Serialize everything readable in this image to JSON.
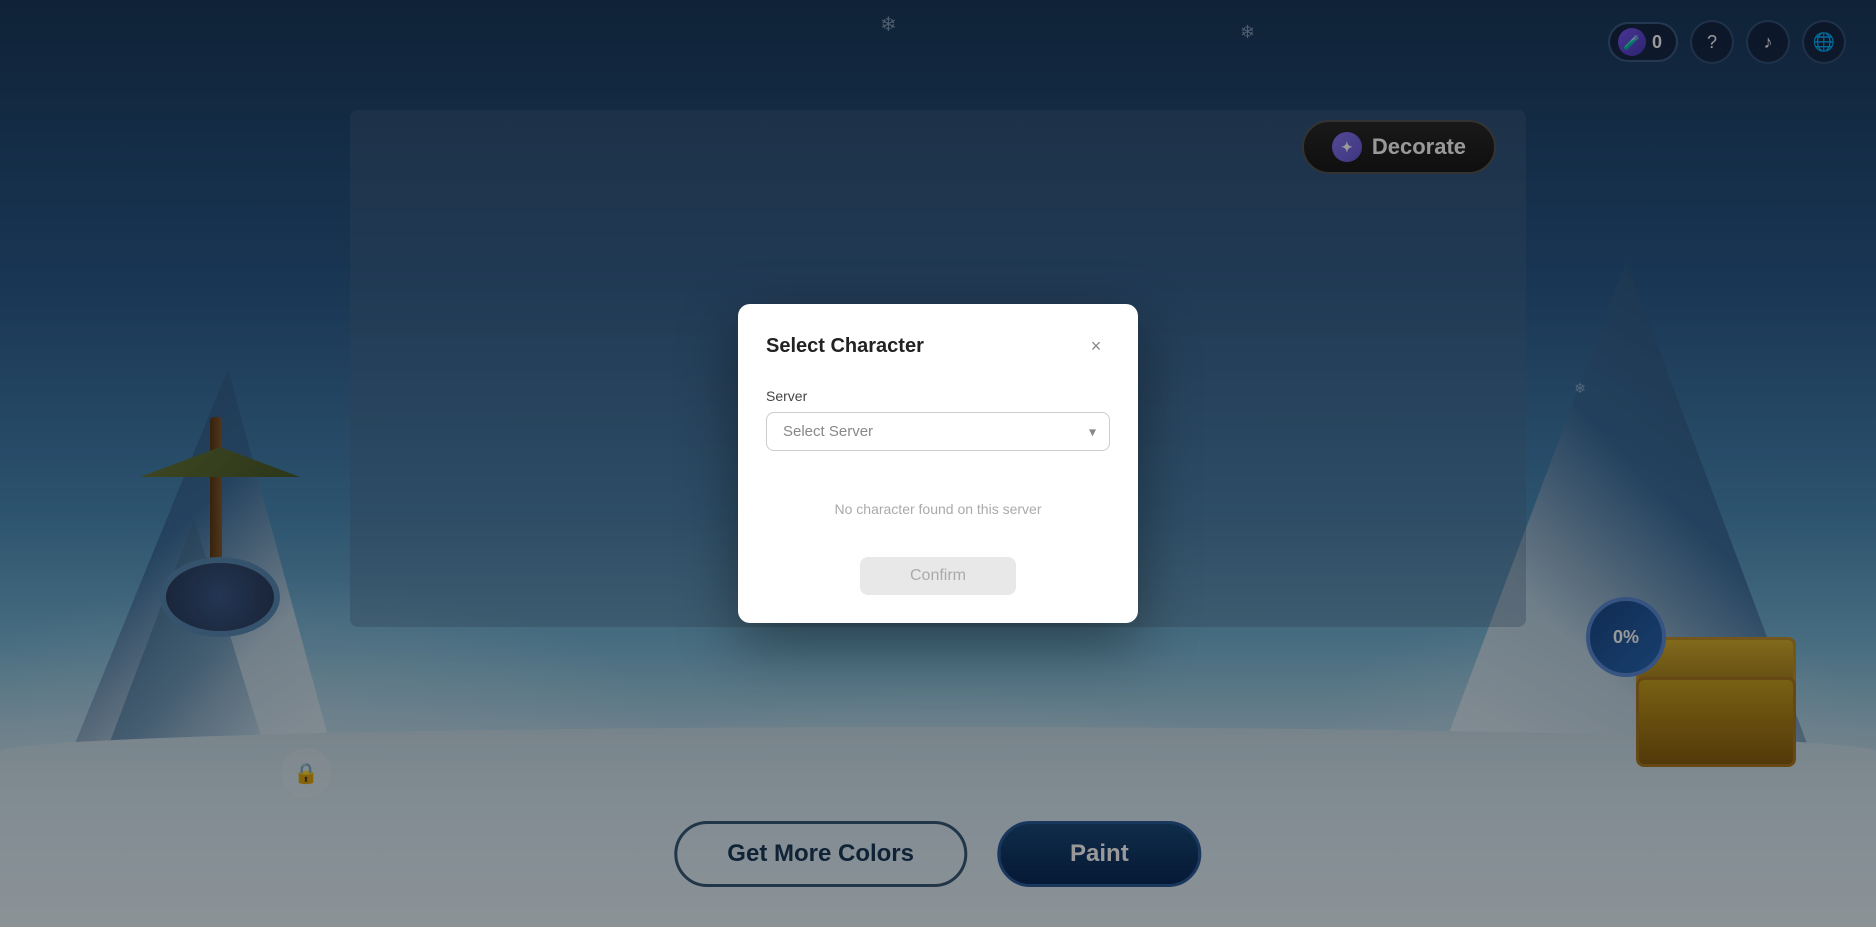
{
  "background": {
    "color_top": "#1a3a5c",
    "color_bottom": "#d8eef8"
  },
  "top_right": {
    "currency_icon": "🧪",
    "currency_value": "0",
    "help_icon": "?",
    "music_icon": "♪",
    "globe_icon": "🌐"
  },
  "decorate_button": {
    "label": "Decorate",
    "icon": "✦"
  },
  "progress_badge": {
    "value": "0%"
  },
  "modal": {
    "title": "Select Character",
    "close_label": "×",
    "server_label": "Server",
    "server_placeholder": "Select Server",
    "no_character_text": "No character found on this server",
    "confirm_label": "Confirm"
  },
  "bottom_buttons": {
    "get_colors_label": "Get More Colors",
    "paint_label": "Paint"
  }
}
